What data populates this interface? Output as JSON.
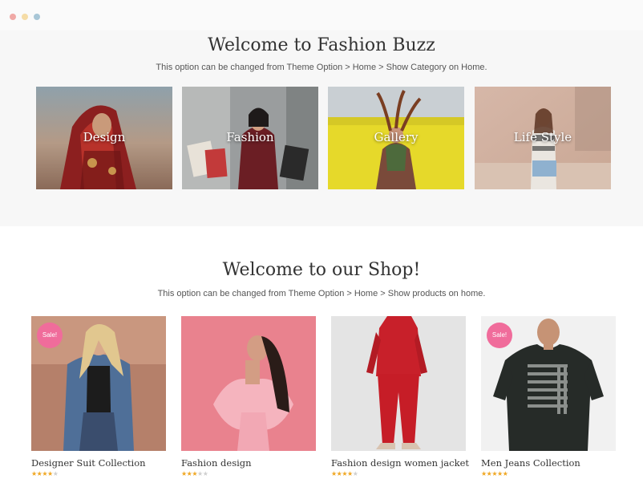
{
  "window": {
    "controls": [
      {
        "name": "close",
        "color": "#f0a9a6"
      },
      {
        "name": "minimize",
        "color": "#f5dca6"
      },
      {
        "name": "maximize",
        "color": "#a8c6d6"
      }
    ]
  },
  "categories": {
    "title": "Welcome to Fashion Buzz",
    "subtitle": "This option can be changed from Theme Option > Home > Show Category on Home.",
    "items": [
      {
        "label": "Design"
      },
      {
        "label": "Fashion"
      },
      {
        "label": "Gallery"
      },
      {
        "label": "Life Style"
      }
    ]
  },
  "shop": {
    "title": "Welcome to our Shop!",
    "subtitle": "This option can be changed from Theme Option > Home > Show products on home.",
    "products": [
      {
        "name": "Designer Suit Collection",
        "sale": "Sale!",
        "rating": 4,
        "max_rating": 5
      },
      {
        "name": "Fashion design",
        "sale": "",
        "rating": 3,
        "max_rating": 5
      },
      {
        "name": "Fashion design women jacket",
        "sale": "",
        "rating": 4,
        "max_rating": 5
      },
      {
        "name": "Men Jeans Collection",
        "sale": "Sale!",
        "rating": 4.5,
        "max_rating": 5
      }
    ]
  },
  "colors": {
    "sale_badge": "#f06c9b",
    "star_on": "#f0a722",
    "star_off": "#cfcfcf",
    "category_bg": "#f7f7f7"
  }
}
